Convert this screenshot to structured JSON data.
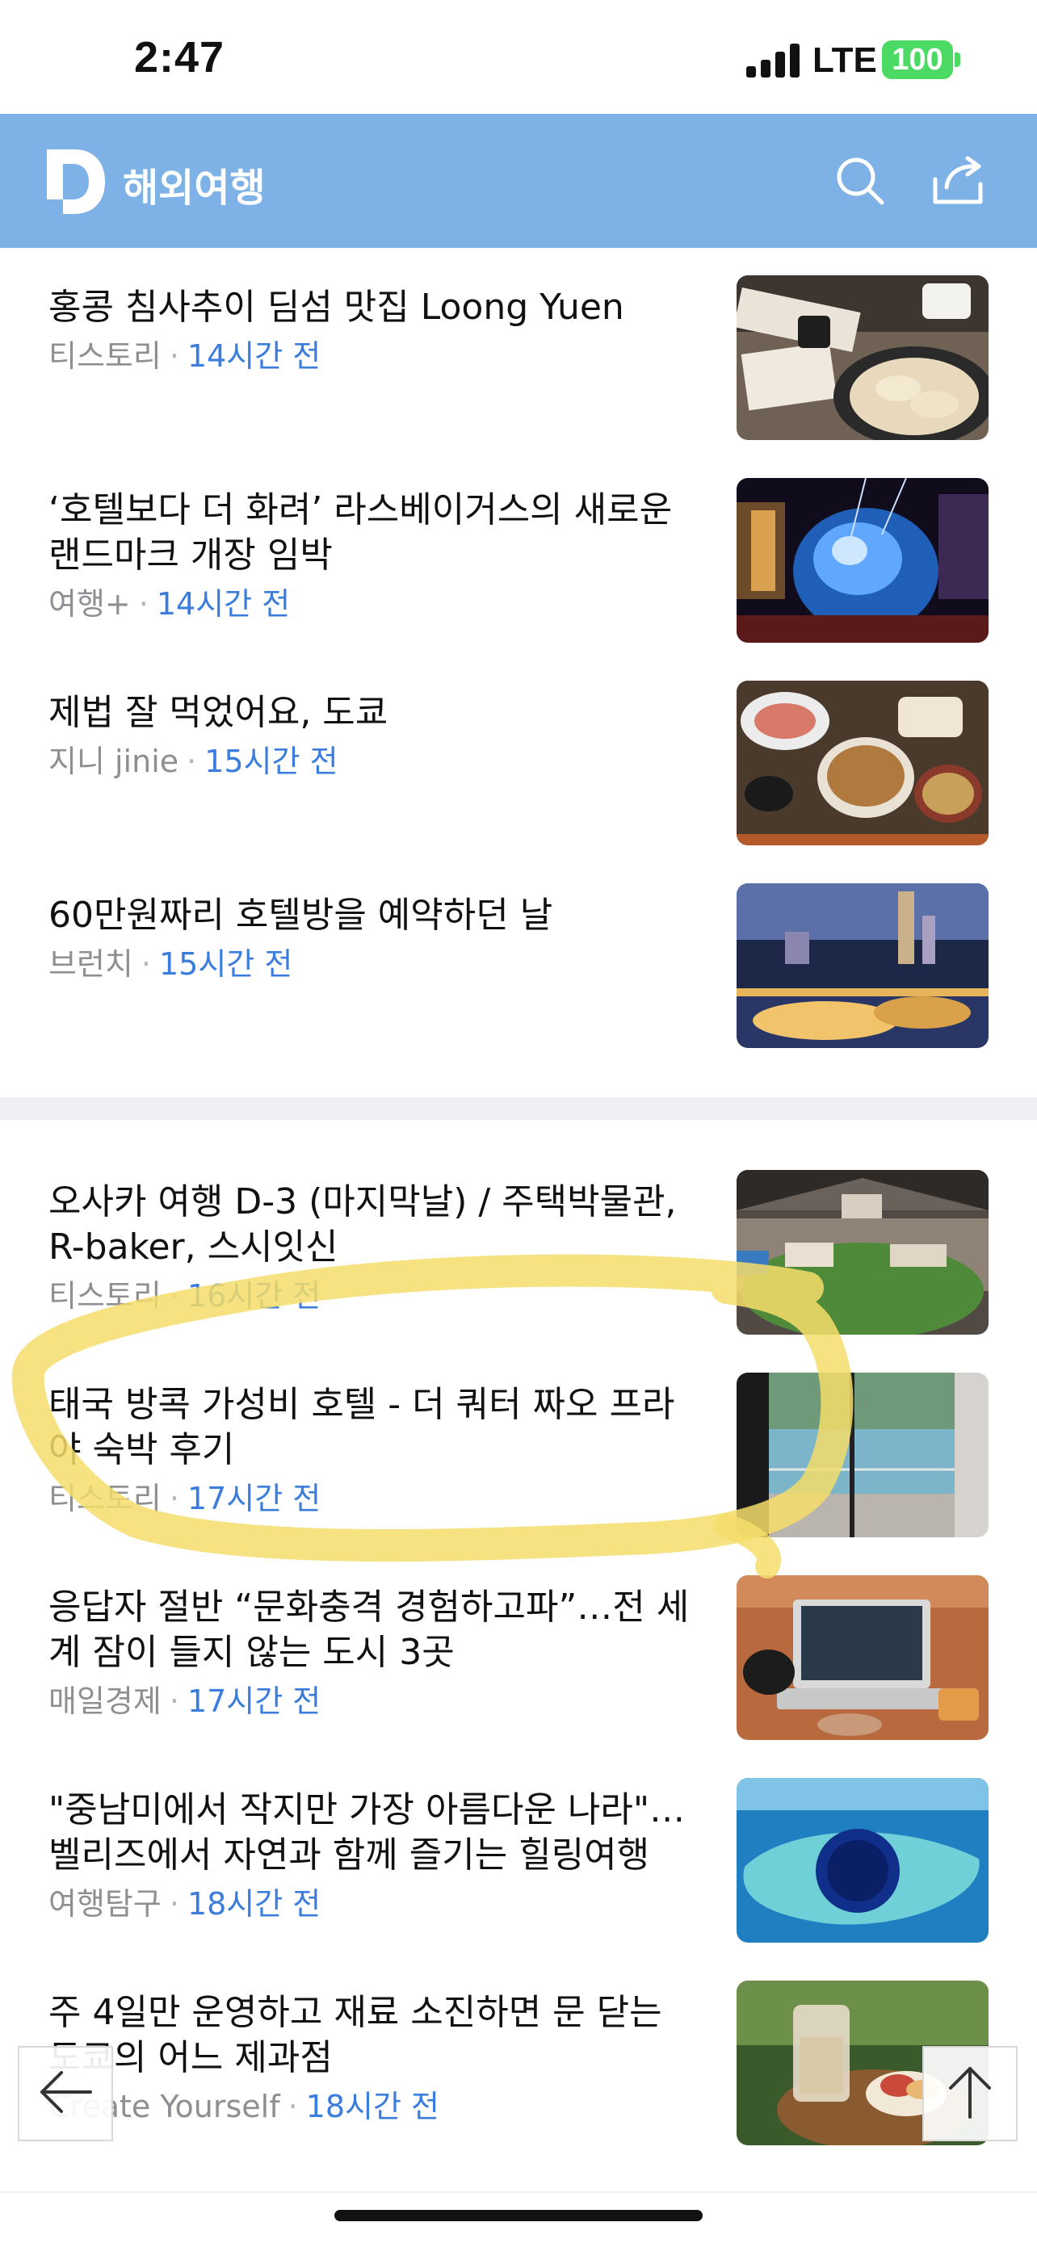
{
  "status_bar": {
    "time": "2:47",
    "network": "LTE",
    "battery": "100",
    "battery_color": "#4cd964"
  },
  "header": {
    "logo_letter": "D",
    "title": "해외여행",
    "background": "#7eb2e6",
    "search_icon": "search-icon",
    "share_icon": "share-icon"
  },
  "articles": [
    {
      "title": "홍콩 침사추이 딤섬 맛집 Loong Yuen",
      "source": "티스토리",
      "time": "14시간 전",
      "thumb": "dim-sum-photo"
    },
    {
      "title": "‘호텔보다 더 화려’ 라스베이거스의 새로운 랜드마크 개장 임박",
      "source": "여행+",
      "time": "14시간 전",
      "thumb": "las-vegas-sphere-photo"
    },
    {
      "title": "제법 잘 먹었어요, 도쿄",
      "source": "지니 jinie",
      "time": "15시간 전",
      "thumb": "japanese-meal-photo"
    },
    {
      "title": "60만원짜리 호텔방을 예약하던 날",
      "source": "브런치",
      "time": "15시간 전",
      "thumb": "city-night-photo"
    },
    {
      "title": "오사카 여행 D-3 (마지막날) / 주택박물관, R-baker, 스시잇신",
      "source": "티스토리",
      "time": "16시간 전",
      "thumb": "theme-park-photo"
    },
    {
      "title": "태국 방콕 가성비 호텔 - 더 쿼터 짜오 프라야 숙박 후기",
      "source": "티스토리",
      "time": "17시간 전",
      "thumb": "hotel-pool-photo"
    },
    {
      "title": "응답자 절반 “문화충격 경험하고파”…전 세계 잠이 들지 않는 도시 3곳",
      "source": "매일경제",
      "time": "17시간 전",
      "thumb": "laptop-desk-photo"
    },
    {
      "title": "\"중남미에서 작지만 가장 아름다운 나라\"… 벨리즈에서 자연과 함께 즐기는 힐링여행",
      "source": "여행탐구",
      "time": "18시간 전",
      "thumb": "blue-hole-photo"
    },
    {
      "title": "주 4일만 운영하고 재료 소진하면 문 닫는 도쿄의 어느 제과점",
      "source": "Create Yourself",
      "time": "18시간 전",
      "thumb": "cafe-pastry-photo"
    }
  ],
  "controls": {
    "back_icon": "arrow-left-icon",
    "top_icon": "arrow-up-icon"
  },
  "annotation": {
    "color": "#f7e27a"
  }
}
